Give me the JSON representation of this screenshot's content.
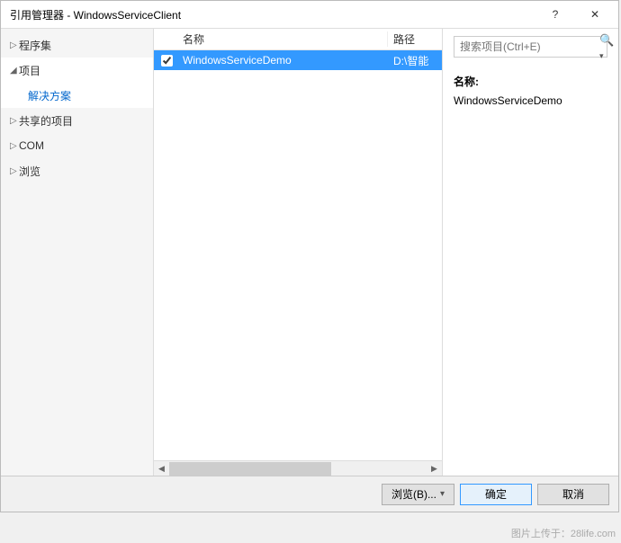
{
  "window": {
    "title": "引用管理器 - WindowsServiceClient"
  },
  "sidebar": {
    "items": [
      {
        "label": "程序集",
        "expanded": false,
        "active": false
      },
      {
        "label": "项目",
        "expanded": true,
        "active": true,
        "children": [
          {
            "label": "解决方案"
          }
        ]
      },
      {
        "label": "共享的项目",
        "expanded": false,
        "active": false
      },
      {
        "label": "COM",
        "expanded": false,
        "active": false
      },
      {
        "label": "浏览",
        "expanded": false,
        "active": false
      }
    ]
  },
  "search": {
    "placeholder": "搜索项目(Ctrl+E)"
  },
  "columns": {
    "name": "名称",
    "path": "路径"
  },
  "rows": [
    {
      "checked": true,
      "selected": true,
      "name": "WindowsServiceDemo",
      "path": "D:\\智能"
    }
  ],
  "detail": {
    "label": "名称:",
    "value": "WindowsServiceDemo"
  },
  "footer": {
    "browse": "浏览(B)...",
    "ok": "确定",
    "cancel": "取消"
  },
  "watermark": "图片上传于：28life.com"
}
